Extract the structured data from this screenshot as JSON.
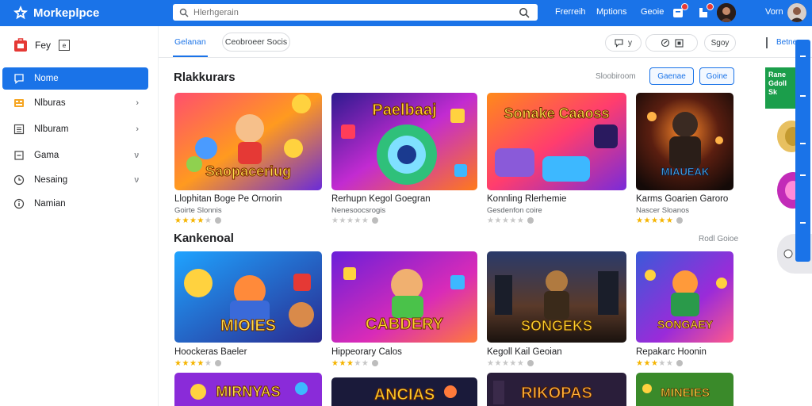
{
  "header": {
    "app_title": "Morkeplpce",
    "search_placeholder": "Hlerhgerain",
    "nav": [
      "Frerreih",
      "Mptions",
      "Geoie"
    ],
    "user_name": "Vorn",
    "accent": "#1a73e8"
  },
  "sidebar": {
    "head_label": "Fey",
    "head_box": "e",
    "items": [
      {
        "label": "Nome",
        "icon": "chat-icon",
        "active": true,
        "chevron": ""
      },
      {
        "label": "Nlburas",
        "icon": "grid-icon",
        "active": false,
        "chevron": "›"
      },
      {
        "label": "Nlburam",
        "icon": "list-icon",
        "active": false,
        "chevron": "›"
      },
      {
        "label": "Gama",
        "icon": "box-icon",
        "active": false,
        "chevron": "ν"
      },
      {
        "label": "Nesaing",
        "icon": "clock-icon",
        "active": false,
        "chevron": "ν"
      },
      {
        "label": "Namian",
        "icon": "info-icon",
        "active": false,
        "chevron": ""
      }
    ]
  },
  "tabs": {
    "active": "Gelanan",
    "pill": "Ceobroeer Socis",
    "right_pill_1": "y",
    "right_pill_3": "Sgoy",
    "right_edge": "Betne"
  },
  "section1": {
    "title": "Rlakkurars",
    "link": "Sloobiroom",
    "btn1": "Gaenae",
    "btn2": "Goine",
    "cards": [
      {
        "title": "Llophitan Boge Pe Ornorin",
        "sub": "Goirte Slonnis",
        "rating": 4,
        "art_text": "Saopaceriug"
      },
      {
        "title": "Rerhupn Kegol Goegran",
        "sub": "Nenesoocsrogis",
        "rating": 0,
        "art_text": "Paelbaaj"
      },
      {
        "title": "Konnling Rlerhemie",
        "sub": "Gesdenfon coire",
        "rating": 0,
        "art_text": "Sonake Caaoss"
      },
      {
        "title": "Karms Goarien Garoro",
        "sub": "Nascer Sloanos",
        "rating": 5,
        "art_text": "MIAUEAK"
      }
    ]
  },
  "section2": {
    "title": "Kankenoal",
    "link": "Rodl Goioe",
    "cards": [
      {
        "title": "Hoockeras Baeler",
        "rating": 4,
        "art_text": "MIOIES"
      },
      {
        "title": "Hippeorary Calos",
        "rating": 3,
        "art_text": "CABDERY"
      },
      {
        "title": "Kegoll Kail Geoian",
        "rating": 0,
        "art_text": "SONGEKS"
      },
      {
        "title": "Repakarc Hoonin",
        "rating": 3,
        "art_text": "SONGAEY"
      }
    ]
  },
  "section3": {
    "cards": [
      {
        "art_text": "MIRNYAS"
      },
      {
        "art_text": "ANCIAS"
      },
      {
        "art_text": "RIKOPAS"
      },
      {
        "art_text": "MINEIES"
      }
    ]
  },
  "promo": {
    "green_text": "Rane Gdoll Sk"
  }
}
